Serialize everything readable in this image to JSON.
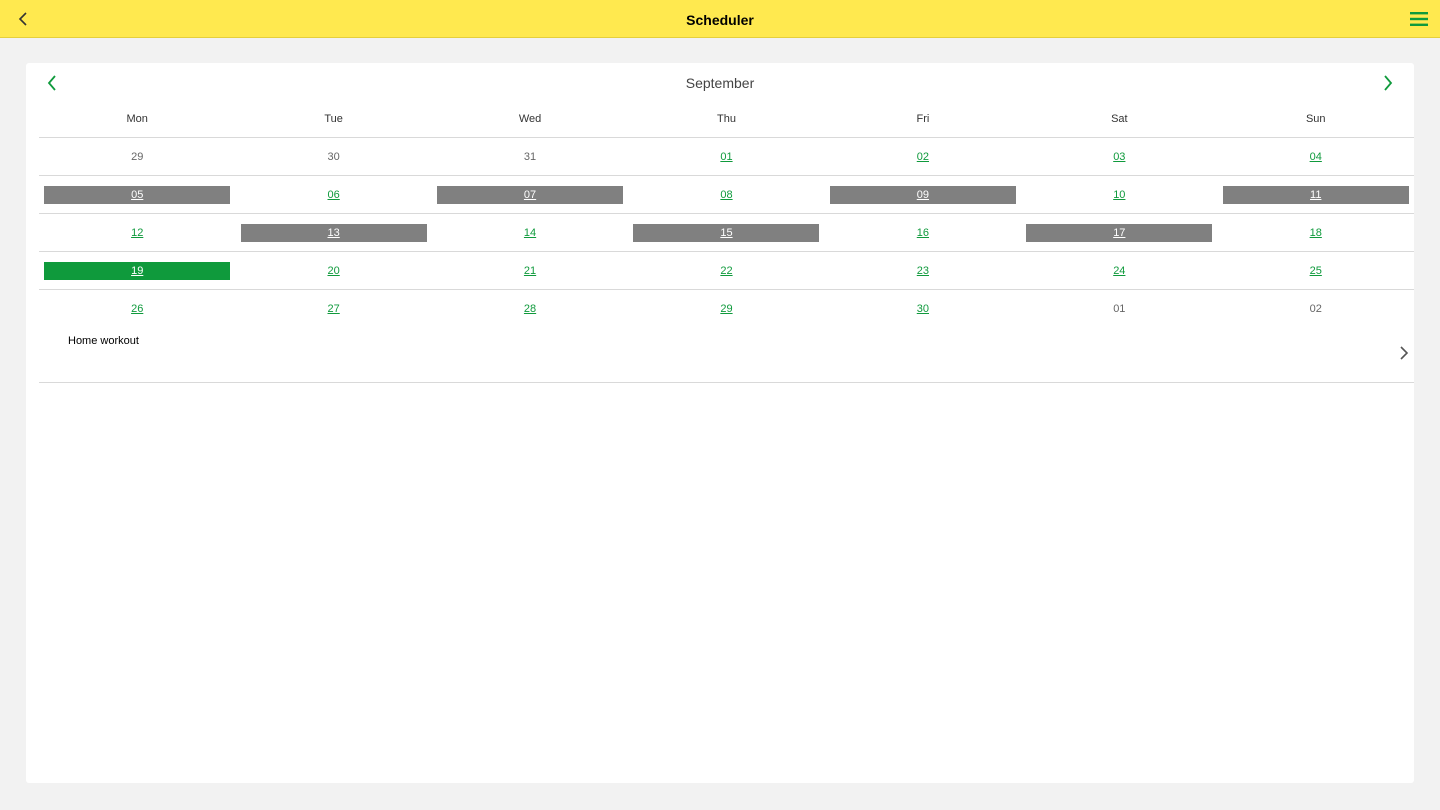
{
  "header": {
    "title": "Scheduler",
    "back_icon": "chevron-left-icon",
    "menu_icon": "hamburger-menu-icon",
    "accent": "#ffe94f"
  },
  "calendar": {
    "month": "September",
    "weekdays": [
      "Mon",
      "Tue",
      "Wed",
      "Thu",
      "Fri",
      "Sat",
      "Sun"
    ],
    "colors": {
      "link": "#0f9a3c",
      "workout": "#808080",
      "today": "#0f9a3c"
    },
    "weeks": [
      [
        {
          "label": "29",
          "state": "other"
        },
        {
          "label": "30",
          "state": "other"
        },
        {
          "label": "31",
          "state": "other"
        },
        {
          "label": "01",
          "state": "link"
        },
        {
          "label": "02",
          "state": "link"
        },
        {
          "label": "03",
          "state": "link"
        },
        {
          "label": "04",
          "state": "link"
        }
      ],
      [
        {
          "label": "05",
          "state": "workout"
        },
        {
          "label": "06",
          "state": "link"
        },
        {
          "label": "07",
          "state": "workout"
        },
        {
          "label": "08",
          "state": "link"
        },
        {
          "label": "09",
          "state": "workout"
        },
        {
          "label": "10",
          "state": "link"
        },
        {
          "label": "11",
          "state": "workout"
        }
      ],
      [
        {
          "label": "12",
          "state": "link"
        },
        {
          "label": "13",
          "state": "workout"
        },
        {
          "label": "14",
          "state": "link"
        },
        {
          "label": "15",
          "state": "workout"
        },
        {
          "label": "16",
          "state": "link"
        },
        {
          "label": "17",
          "state": "workout"
        },
        {
          "label": "18",
          "state": "link"
        }
      ],
      [
        {
          "label": "19",
          "state": "today"
        },
        {
          "label": "20",
          "state": "link"
        },
        {
          "label": "21",
          "state": "link"
        },
        {
          "label": "22",
          "state": "link"
        },
        {
          "label": "23",
          "state": "link"
        },
        {
          "label": "24",
          "state": "link"
        },
        {
          "label": "25",
          "state": "link"
        }
      ],
      [
        {
          "label": "26",
          "state": "link"
        },
        {
          "label": "27",
          "state": "link"
        },
        {
          "label": "28",
          "state": "link"
        },
        {
          "label": "29",
          "state": "link"
        },
        {
          "label": "30",
          "state": "link"
        },
        {
          "label": "01",
          "state": "other"
        },
        {
          "label": "02",
          "state": "other"
        }
      ]
    ]
  },
  "events": [
    {
      "label": "Home workout",
      "icon": "chevron-right-icon"
    }
  ]
}
